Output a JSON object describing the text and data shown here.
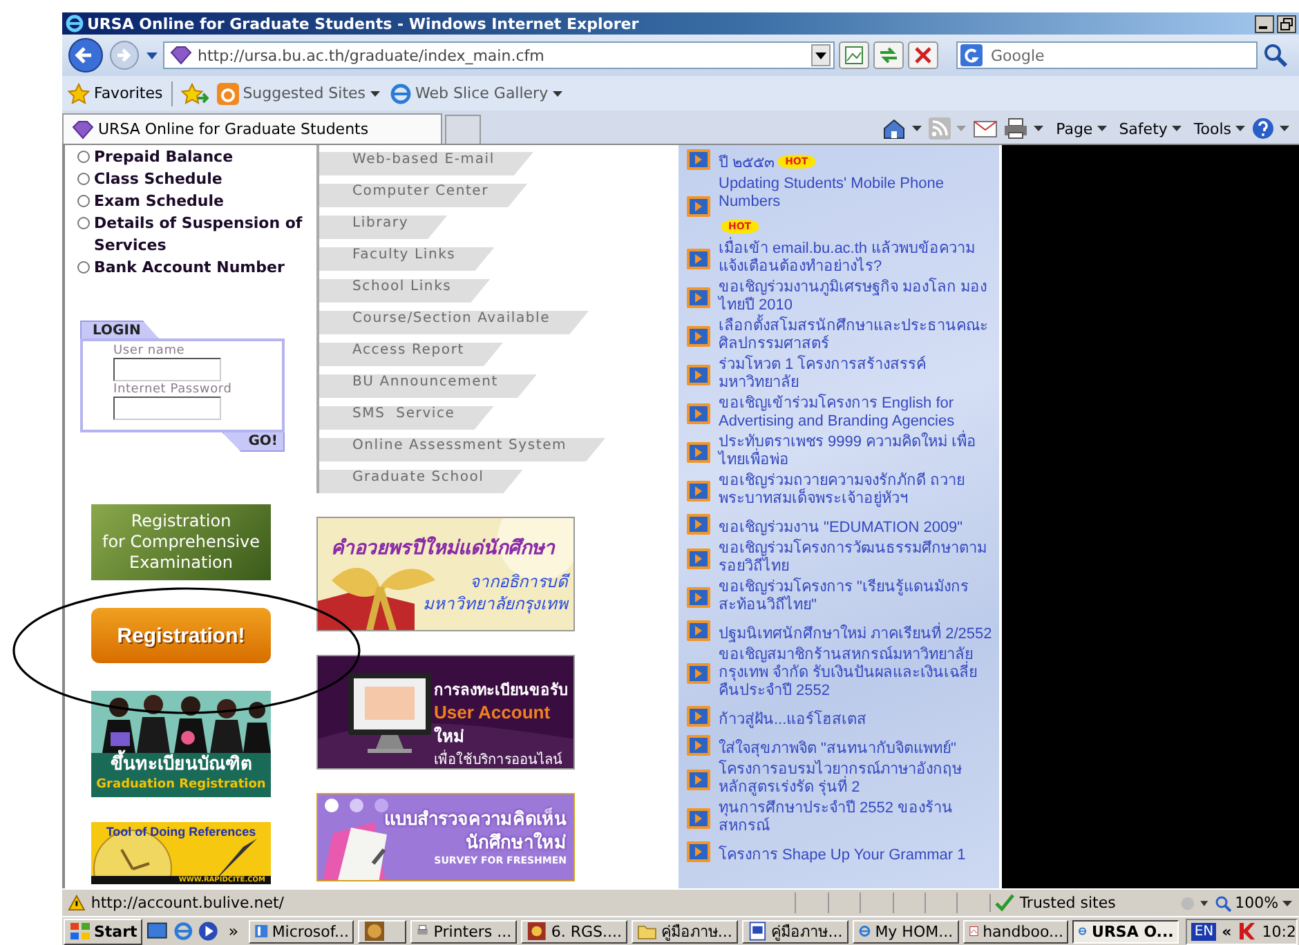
{
  "window": {
    "title": "URSA Online for Graduate Students - Windows Internet Explorer"
  },
  "address_bar": {
    "url": "http://ursa.bu.ac.th/graduate/index_main.cfm"
  },
  "search": {
    "placeholder": "Google"
  },
  "favorites_bar": {
    "label": "Favorites",
    "links": [
      "Suggested Sites",
      "Web Slice Gallery"
    ]
  },
  "tabs": [
    {
      "label": "URSA Online for Graduate Students",
      "selected": true
    }
  ],
  "command_bar": [
    "Page",
    "Safety",
    "Tools"
  ],
  "left_menu": [
    {
      "label": "Prepaid Balance",
      "selected": false
    },
    {
      "label": "Class Schedule",
      "selected": false
    },
    {
      "label": "Exam Schedule",
      "selected": false
    },
    {
      "label": "Details of Suspension of Services",
      "selected": false
    },
    {
      "label": "Bank Account Number",
      "selected": false
    }
  ],
  "login": {
    "title": "LOGIN",
    "fields": [
      {
        "label": "User name"
      },
      {
        "label": "Internet Password"
      }
    ],
    "button": "GO!"
  },
  "left_banners": [
    {
      "kind": "comprehensive",
      "lines": [
        "Registration",
        "for Comprehensive",
        "Examination"
      ]
    },
    {
      "kind": "registration",
      "lines": [
        "Registration!"
      ]
    },
    {
      "kind": "graduation",
      "lines": [
        "ขึ้นทะเบียนบัณฑิต",
        "Graduation Registration"
      ]
    },
    {
      "kind": "references",
      "lines": [
        "Tool of Doing References",
        "WWW.RAPIDCITE.COM"
      ]
    }
  ],
  "links_menu": [
    "Web-based E-mail",
    "Computer Center",
    "Library",
    "Faculty Links",
    "School Links",
    "Course/Section Available",
    "Access Report",
    "BU Announcement",
    "SMS  Service",
    "Online Assessment System",
    "Graduate School"
  ],
  "center_banners": [
    {
      "kind": "newyear",
      "lines": [
        "คำอวยพรปีใหม่แด่นักศึกษา",
        "จากอธิการบดี",
        "มหาวิทยาลัยกรุงเทพ"
      ]
    },
    {
      "kind": "account",
      "lines": [
        "การลงทะเบียนขอรับ",
        "User Account",
        "ใหม่",
        "เพื่อใช้บริการออนไลน์"
      ]
    },
    {
      "kind": "survey",
      "lines": [
        "แบบสำรวจความคิดเห็น",
        "นักศึกษาใหม่",
        "SURVEY FOR FRESHMEN"
      ]
    }
  ],
  "news": [
    {
      "text": "ปี ๒๕๕๓",
      "badge": "HOT"
    },
    {
      "text": "Updating Students' Mobile Phone Numbers",
      "badge": "HOT"
    },
    {
      "text": "เมื่อเข้า email.bu.ac.th แล้วพบข้อความแจ้งเตือนต้องทำอย่างไร?"
    },
    {
      "text": "ขอเชิญร่วมงานภูมิเศรษฐกิจ มองโลก มองไทยปี 2010"
    },
    {
      "text": "เลือกตั้งสโมสรนักศึกษาและประธานคณะศิลปกรรมศาสตร์"
    },
    {
      "text": "ร่วมโหวต 1 โครงการสร้างสรรค์มหาวิทยาลัย"
    },
    {
      "text": "ขอเชิญเข้าร่วมโครงการ English for Advertising and Branding Agencies"
    },
    {
      "text": "ประทับตราเพชร 9999 ความคิดใหม่ เพื่อไทยเพื่อพ่อ"
    },
    {
      "text": "ขอเชิญร่วมถวายความจงรักภักดี ถวายพระบาทสมเด็จพระเจ้าอยู่หัวฯ"
    },
    {
      "text": "ขอเชิญร่วมงาน \"EDUMATION 2009\""
    },
    {
      "text": "ขอเชิญร่วมโครงการวัฒนธรรมศึกษาตามรอยวิถีไทย"
    },
    {
      "text": "ขอเชิญร่วมโครงการ \"เรียนรู้แดนมังกร สะท้อนวิถีไทย\""
    },
    {
      "text": "ปฐมนิเทศนักศึกษาใหม่ ภาคเรียนที่ 2/2552"
    },
    {
      "text": "ขอเชิญสมาชิกร้านสหกรณ์มหาวิทยาลัยกรุงเทพ จำกัด รับเงินปันผลและเงินเฉลี่ยคืนประจำปี 2552"
    },
    {
      "text": "ก้าวสู่ฝัน...แอร์โฮสเตส"
    },
    {
      "text": "ใส่ใจสุขภาพจิต \"สนทนากับจิตแพทย์\""
    },
    {
      "text": "โครงการอบรมไวยากรณ์ภาษาอังกฤษหลักสูตรเร่งรัด รุ่นที่ 2"
    },
    {
      "text": "ทุนการศึกษาประจำปี 2552 ของร้านสหกรณ์"
    },
    {
      "text": "โครงการ Shape Up Your Grammar 1"
    }
  ],
  "status_bar": {
    "url": "http://account.bulive.net/",
    "zone": "Trusted sites",
    "zoom": "100%"
  },
  "taskbar": {
    "start": "Start",
    "more": "»",
    "items": [
      {
        "label": "Microsof...",
        "selected": false
      },
      {
        "selected": false
      },
      {
        "label": "Printers ...",
        "selected": false
      },
      {
        "label": "6.  RGS....",
        "selected": false
      },
      {
        "label": "คู่มือภาษ...",
        "selected": false
      },
      {
        "label": "คู่มือภาษ...",
        "selected": false
      },
      {
        "label": "My HOM...",
        "selected": false
      },
      {
        "label": "handboo...",
        "selected": false
      },
      {
        "label": "URSA O...",
        "selected": true
      }
    ],
    "language": "EN",
    "tray_chevron": "«",
    "clock": "10:2"
  }
}
